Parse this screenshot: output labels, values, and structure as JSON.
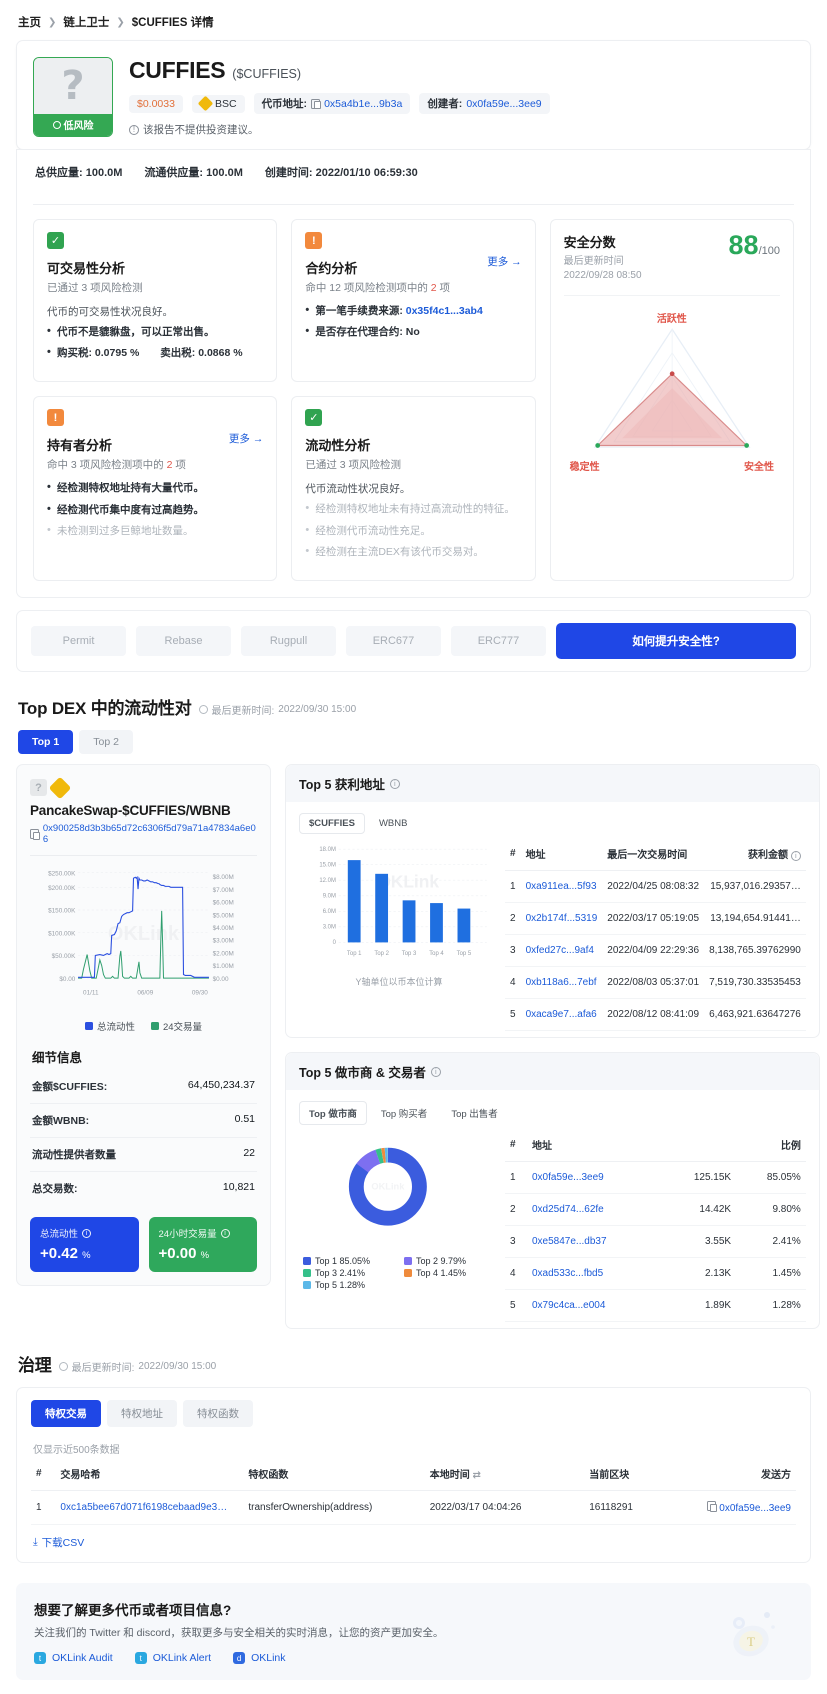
{
  "breadcrumb": {
    "items": [
      "主页",
      "链上卫士",
      "$CUFFIES 详情"
    ]
  },
  "token": {
    "name": "CUFFIES",
    "symbol": "($CUFFIES)",
    "risk_badge": "低风险",
    "logo_glyph": "?",
    "price": "$0.0033",
    "chain": "BSC",
    "contract_label": "代币地址:",
    "contract_addr": "0x5a4b1e...9b3a",
    "creator_label": "创建者:",
    "creator_addr": "0x0fa59e...3ee9",
    "disclaimer": "该报告不提供投资建议。",
    "total_supply_label": "总供应量:",
    "total_supply": "100.0M",
    "circ_supply_label": "流通供应量:",
    "circ_supply": "100.0M",
    "created_label": "创建时间:",
    "created_at": "2022/01/10 06:59:30"
  },
  "analysis": {
    "tradability": {
      "flag": "ok",
      "title": "可交易性分析",
      "sub": "已通过 3 项风险检测",
      "lead": "代币的可交易性状况良好。",
      "items": [
        "代币不是貔貅盘，可以正常出售。",
        "购买税: 0.0795 %　　卖出税: 0.0868 %"
      ]
    },
    "contract": {
      "flag": "warn",
      "title": "合约分析",
      "more": "更多 →",
      "sub_pre": "命中 12 项风险检测项中的 ",
      "sub_num": "2",
      "sub_post": " 项",
      "items": [
        "第一笔手续费来源: 0x35f4c1...3ab4",
        "是否存在代理合约: No"
      ],
      "first_fee_label": "第一笔手续费来源:",
      "first_fee_addr": "0x35f4c1...3ab4",
      "proxy_text": "是否存在代理合约: No"
    },
    "holder": {
      "flag": "warn",
      "title": "持有者分析",
      "more": "更多 →",
      "sub_pre": "命中 3 项风险检测项中的 ",
      "sub_num": "2",
      "sub_post": " 项",
      "items": [
        "经检测特权地址持有大量代币。",
        "经检测代币集中度有过高趋势。"
      ],
      "muted_items": [
        "未检测到过多巨鲸地址数量。"
      ]
    },
    "liquidity": {
      "flag": "ok",
      "title": "流动性分析",
      "sub": "已通过 3 项风险检测",
      "lead": "代币流动性状况良好。",
      "muted_items": [
        "经检测特权地址未有持过高流动性的特征。",
        "经检测代币流动性充足。",
        "经检测在主流DEX有该代币交易对。"
      ]
    },
    "score": {
      "title": "安全分数",
      "updated_label": "最后更新时间",
      "updated_at": "2022/09/28 08:50",
      "value": "88",
      "denominator": "/100",
      "axes": [
        "活跃性",
        "稳定性",
        "安全性"
      ],
      "chart_data": {
        "type": "radar",
        "title": "安全分数",
        "categories": [
          "活跃性",
          "稳定性",
          "安全性"
        ],
        "values": [
          62,
          88,
          90
        ],
        "max": 100,
        "fill_color": "#e9a5a5",
        "stroke_color": "#d98b8b"
      }
    }
  },
  "tagbar": {
    "tags": [
      "Permit",
      "Rebase",
      "Rugpull",
      "ERC677",
      "ERC777"
    ],
    "cta": "如何提升安全性?"
  },
  "dex_section": {
    "title": "Top DEX 中的流动性对",
    "updated_label": "最后更新时间:",
    "updated_at": "2022/09/30 15:00",
    "tabs": [
      {
        "label": "Top 1",
        "active": true
      },
      {
        "label": "Top 2",
        "active": false
      }
    ]
  },
  "pair": {
    "name": "PancakeSwap-$CUFFIES/WBNB",
    "address": "0x900258d3b3b65d72c6306f5d79a71a47834a6e06",
    "chart_data": {
      "type": "line",
      "title": "流动性与交易量",
      "xlabel": "",
      "ylabel": "",
      "x_ticks": [
        "01/11",
        "06/09",
        "09/30"
      ],
      "y_left_ticks": [
        "$0.00",
        "$50.00K",
        "$100.00K",
        "$150.00K",
        "$200.00K",
        "$250.00K"
      ],
      "y_right_ticks": [
        "$0.00",
        "$1.00M",
        "$2.00M",
        "$3.00M",
        "$4.00M",
        "$5.00M",
        "$6.00M",
        "$7.00M",
        "$8.00M"
      ],
      "ylim_left": [
        0,
        250000
      ],
      "ylim_right": [
        0,
        8000000
      ],
      "series": [
        {
          "name": "总流动性",
          "color": "#2b4fe0",
          "axis": "left",
          "values": [
            2000,
            2200,
            2500,
            2600,
            3000,
            3200,
            3500,
            4000,
            52000,
            54000,
            53000,
            55000,
            54000,
            60000,
            95000,
            105000,
            140000,
            143000,
            146000,
            148000,
            150000,
            232000,
            236000,
            200000,
            228000,
            228000,
            227000,
            226000,
            225000,
            226000,
            224000,
            222000,
            218000,
            216000,
            216000,
            216000,
            215000,
            214000,
            213000,
            8000,
            8000,
            7500,
            7500,
            7000,
            7000,
            6800,
            6600
          ]
        },
        {
          "name": "24交易量",
          "color": "#2f9e6e",
          "axis": "right",
          "values": [
            200000,
            300000,
            1900000,
            400000,
            200000,
            1700000,
            600000,
            200000,
            150000,
            120000,
            100000,
            90000,
            1600000,
            120000,
            100000,
            4200000,
            110000,
            100000,
            900000,
            90000,
            80000,
            70000,
            60000,
            55000,
            50000,
            7200000,
            45000,
            40000,
            38000,
            36000,
            34000,
            32000,
            30000,
            28000,
            26000,
            24000,
            22000,
            20000,
            18000,
            16000,
            14000,
            12000,
            10000,
            9000,
            8000,
            7000,
            6000
          ]
        }
      ],
      "legend": [
        "总流动性",
        "24交易量"
      ],
      "watermark": "OKLink"
    },
    "details_title": "细节信息",
    "details": [
      {
        "key": "金额$CUFFIES:",
        "value": "64,450,234.37"
      },
      {
        "key": "金额WBNB:",
        "value": "0.51"
      },
      {
        "key": "流动性提供者数量",
        "value": "22"
      },
      {
        "key": "总交易数:",
        "value": "10,821"
      }
    ],
    "stats": [
      {
        "label": "总流动性",
        "value": "+0.42",
        "unit": "%",
        "color": "blue"
      },
      {
        "label": "24小时交易量",
        "value": "+0.00",
        "unit": "%",
        "color": "green"
      }
    ]
  },
  "profit": {
    "title": "Top 5 获利地址",
    "tabs": [
      {
        "label": "$CUFFIES",
        "active": true
      },
      {
        "label": "WBNB",
        "active": false
      }
    ],
    "axis_note": "Y轴单位以币本位计算",
    "chart_data": {
      "type": "bar",
      "title": "Top 5 获利地址",
      "categories": [
        "Top 1",
        "Top 2",
        "Top 3",
        "Top 4",
        "Top 5"
      ],
      "values": [
        15937016.29,
        13194654.91,
        8138765.4,
        7519730.34,
        6463921.64
      ],
      "y_ticks": [
        "0",
        "3.0M",
        "6.0M",
        "9.0M",
        "12.0M",
        "15.0M",
        "18.0M"
      ],
      "ylim": [
        0,
        18000000
      ],
      "xlabel": "",
      "ylabel": "Y轴单位以币本位计算",
      "bar_color": "#1f6fe0",
      "watermark": "OKLink"
    },
    "columns": [
      "#",
      "地址",
      "最后一次交易时间",
      "获利金额"
    ],
    "rows": [
      {
        "n": "1",
        "addr": "0xa911ea...5f93",
        "time": "2022/04/25 08:08:32",
        "amount": "15,937,016.29357…"
      },
      {
        "n": "2",
        "addr": "0x2b174f...5319",
        "time": "2022/03/17 05:19:05",
        "amount": "13,194,654.91441…"
      },
      {
        "n": "3",
        "addr": "0xfed27c...9af4",
        "time": "2022/04/09 22:29:36",
        "amount": "8,138,765.39762990"
      },
      {
        "n": "4",
        "addr": "0xb118a6...7ebf",
        "time": "2022/08/03 05:37:01",
        "amount": "7,519,730.33535453"
      },
      {
        "n": "5",
        "addr": "0xaca9e7...afa6",
        "time": "2022/08/12 08:41:09",
        "amount": "6,463,921.63647276"
      }
    ]
  },
  "makers": {
    "title": "Top 5 做市商 & 交易者",
    "tabs": [
      {
        "label": "Top 做市商",
        "active": true
      },
      {
        "label": "Top 购买者",
        "active": false
      },
      {
        "label": "Top 出售者",
        "active": false
      }
    ],
    "chart_data": {
      "type": "pie",
      "title": "Top 5 做市商 & 交易者",
      "labels": [
        "Top 1",
        "Top 2",
        "Top 3",
        "Top 4",
        "Top 5"
      ],
      "values": [
        85.05,
        9.79,
        2.41,
        1.45,
        1.28
      ],
      "colors": [
        "#3b5cde",
        "#7d6ff0",
        "#35c08a",
        "#ef8b3c",
        "#5cb8e8"
      ],
      "legend": [
        "Top 1 85.05%",
        "Top 2 9.79%",
        "Top 3 2.41%",
        "Top 4 1.45%",
        "Top 5 1.28%"
      ],
      "watermark": "OKLink",
      "donut": true
    },
    "columns": [
      "#",
      "地址",
      "",
      "比例"
    ],
    "rows": [
      {
        "n": "1",
        "addr": "0x0fa59e...3ee9",
        "amount": "125.15K",
        "ratio": "85.05%"
      },
      {
        "n": "2",
        "addr": "0xd25d74...62fe",
        "amount": "14.42K",
        "ratio": "9.80%"
      },
      {
        "n": "3",
        "addr": "0xe5847e...db37",
        "amount": "3.55K",
        "ratio": "2.41%"
      },
      {
        "n": "4",
        "addr": "0xad533c...fbd5",
        "amount": "2.13K",
        "ratio": "1.45%"
      },
      {
        "n": "5",
        "addr": "0x79c4ca...e004",
        "amount": "1.89K",
        "ratio": "1.28%"
      }
    ]
  },
  "governance": {
    "title": "治理",
    "updated_label": "最后更新时间:",
    "updated_at": "2022/09/30 15:00",
    "tabs": [
      {
        "label": "特权交易",
        "active": true
      },
      {
        "label": "特权地址",
        "active": false
      },
      {
        "label": "特权函数",
        "active": false
      }
    ],
    "note": "仅显示近500条数据",
    "columns": [
      "#",
      "交易哈希",
      "特权函数",
      "本地时间",
      "当前区块",
      "发送方"
    ],
    "rows": [
      {
        "n": "1",
        "hash": "0xc1a5bee67d071f6198cebaad9e3…",
        "func": "transferOwnership(address)",
        "time": "2022/03/17 04:04:26",
        "block": "16118291",
        "sender": "0x0fa59e...3ee9"
      }
    ],
    "download": "下载CSV"
  },
  "footer": {
    "title": "想要了解更多代币或者项目信息?",
    "desc": "关注我们的 Twitter 和 discord，获取更多与安全相关的实时消息，让您的资产更加安全。",
    "links": [
      "OKLink Audit",
      "OKLink Alert",
      "OKLink"
    ]
  },
  "colors": {
    "accent": "#1f47e6",
    "link": "#1c5bd8",
    "ok": "#30a350",
    "warn": "#f2893d",
    "danger": "#e0564a",
    "score": "#2aa85a"
  }
}
